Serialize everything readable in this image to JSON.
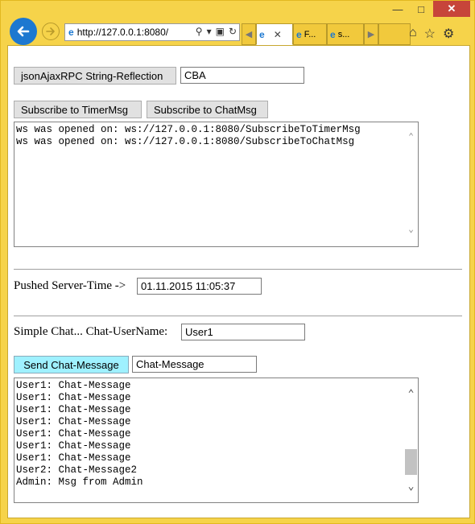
{
  "browser": {
    "url": "http://127.0.0.1:8080/",
    "tabs": [
      {
        "label": "",
        "close": "✕"
      },
      {
        "label": "F..."
      },
      {
        "label": "s..."
      }
    ]
  },
  "rpc": {
    "button_label": "jsonAjaxRPC String-Reflection",
    "input_value": "CBA"
  },
  "subscribe": {
    "timer_button": "Subscribe to TimerMsg",
    "chat_button": "Subscribe to ChatMsg",
    "log": [
      "ws was opened on: ws://127.0.0.1:8080/SubscribeToTimerMsg",
      "ws was opened on: ws://127.0.0.1:8080/SubscribeToChatMsg"
    ]
  },
  "server_time": {
    "label": "Pushed Server-Time ->",
    "value": "01.11.2015 11:05:37"
  },
  "chat": {
    "user_label": "Simple Chat... Chat-UserName:",
    "user_value": "User1",
    "send_button": "Send Chat-Message",
    "message_value": "Chat-Message",
    "log": [
      "User1: Chat-Message",
      "User1: Chat-Message",
      "User1: Chat-Message",
      "User1: Chat-Message",
      "User1: Chat-Message",
      "User1: Chat-Message",
      "User1: Chat-Message",
      "User2: Chat-Message2",
      "Admin: Msg from Admin"
    ]
  },
  "icons": {
    "back": "back-arrow-icon",
    "forward": "forward-arrow-icon",
    "home": "home-icon",
    "favorites": "star-icon",
    "settings": "gear-icon"
  },
  "colors": {
    "window_frame": "#f6d34a",
    "back_button": "#1d78d0",
    "send_button": "#9ff1ff",
    "close_button": "#c7453a"
  }
}
